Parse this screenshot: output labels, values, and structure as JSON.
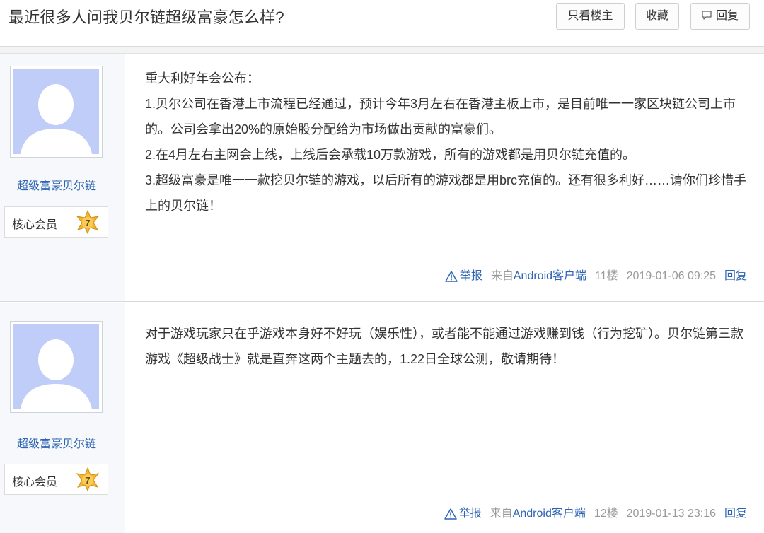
{
  "thread": {
    "title": "最近很多人问我贝尔链超级富豪怎么样?",
    "buttons": {
      "author_only": "只看楼主",
      "favorite": "收藏",
      "reply": "回复"
    }
  },
  "posts": [
    {
      "username": "超级富豪贝尔链",
      "member_label": "核心会员",
      "level": "7",
      "content": [
        "重大利好年会公布：",
        "1.贝尔公司在香港上市流程已经通过，预计今年3月左右在香港主板上市，是目前唯一一家区块链公司上市的。公司会拿出20%的原始股分配给为市场做出贡献的富豪们。",
        "2.在4月左右主网会上线，上线后会承载10万款游戏，所有的游戏都是用贝尔链充值的。",
        "3.超级富豪是唯一一款挖贝尔链的游戏，以后所有的游戏都是用brc充值的。还有很多利好……请你们珍惜手上的贝尔链！"
      ],
      "report_label": "举报",
      "source_prefix": "来自",
      "source_app": "Android客户端",
      "floor": "11楼",
      "time": "2019-01-06 09:25",
      "reply_label": "回复"
    },
    {
      "username": "超级富豪贝尔链",
      "member_label": "核心会员",
      "level": "7",
      "content": [
        "对于游戏玩家只在乎游戏本身好不好玩（娱乐性），或者能不能通过游戏赚到钱（行为挖矿）。贝尔链第三款游戏《超级战士》就是直奔这两个主题去的，1.22日全球公测，敬请期待！"
      ],
      "report_label": "举报",
      "source_prefix": "来自",
      "source_app": "Android客户端",
      "floor": "12楼",
      "time": "2019-01-13 23:16",
      "reply_label": "回复"
    }
  ],
  "icons": {
    "reply": "speech-bubble-icon",
    "report": "warning-triangle-icon",
    "avatar": "default-avatar-silhouette",
    "level": "star-level-badge-icon"
  },
  "colors": {
    "link": "#2d64b3",
    "avatar_bg": "#bfcdf8",
    "sidebar_bg": "#f6f8fb",
    "muted": "#999999",
    "badge_gold": "#f2b431"
  }
}
